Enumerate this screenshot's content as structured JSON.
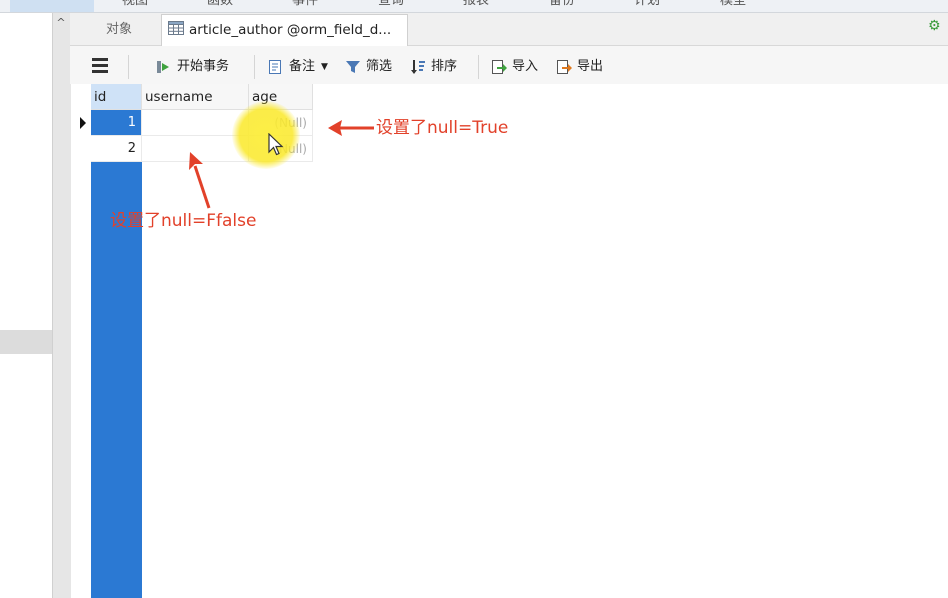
{
  "menu": [
    "视图",
    "函数",
    "事件",
    "查询",
    "报表",
    "备份",
    "计划",
    "模型"
  ],
  "tabs": {
    "objects_label": "对象",
    "active_label": "article_author @orm_field_d..."
  },
  "toolbar": {
    "begin_transaction": "开始事务",
    "note": "备注",
    "filter": "筛选",
    "sort": "排序",
    "import": "导入",
    "export": "导出"
  },
  "table": {
    "columns": [
      "id",
      "username",
      "age"
    ],
    "rows": [
      {
        "id": "1",
        "username": "",
        "age": "(Null)"
      },
      {
        "id": "2",
        "username": "",
        "age": "(Null)"
      }
    ]
  },
  "annotations": {
    "right": "设置了null=True",
    "below": "设置了null=Ffalse"
  },
  "colors": {
    "annotation": "#e2412a",
    "selection": "#2b79d3",
    "highlight": "#fcee3c"
  }
}
